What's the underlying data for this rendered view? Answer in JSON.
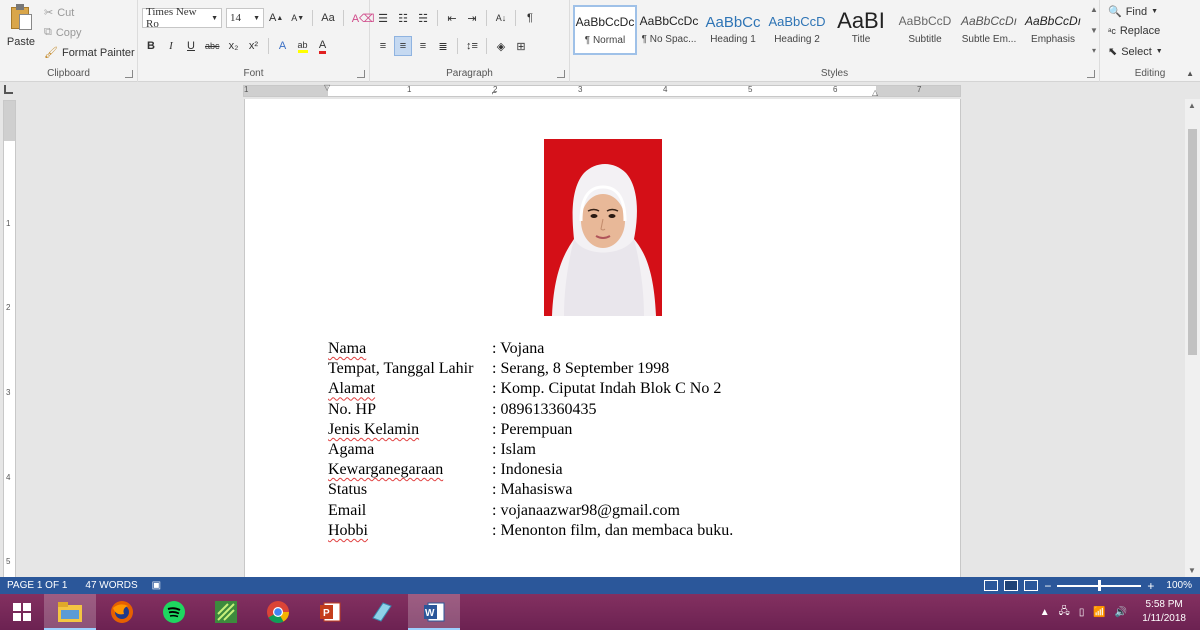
{
  "ribbon": {
    "clipboard": {
      "paste": "Paste",
      "cut": "Cut",
      "copy": "Copy",
      "format_painter": "Format Painter",
      "label": "Clipboard"
    },
    "font": {
      "family": "Times New Ro",
      "size": "14",
      "grow": "A",
      "shrink": "A",
      "change_case": "Aa",
      "bold": "B",
      "italic": "I",
      "underline": "U",
      "strikethrough": "abc",
      "subscript": "x₂",
      "superscript": "x²",
      "text_effects": "A",
      "highlight": "ab",
      "font_color": "A",
      "label": "Font"
    },
    "paragraph": {
      "show_marks": "¶",
      "label": "Paragraph"
    },
    "styles": {
      "items": [
        {
          "preview": "AaBbCcDc",
          "name": "¶ Normal"
        },
        {
          "preview": "AaBbCcDc",
          "name": "¶ No Spac..."
        },
        {
          "preview": "AaBbCc",
          "name": "Heading 1"
        },
        {
          "preview": "AaBbCcD",
          "name": "Heading 2"
        },
        {
          "preview": "AaBI",
          "name": "Title"
        },
        {
          "preview": "AaBbCcD",
          "name": "Subtitle"
        },
        {
          "preview": "AaBbCcDı",
          "name": "Subtle Em..."
        },
        {
          "preview": "AaBbCcDı",
          "name": "Emphasis"
        }
      ],
      "label": "Styles"
    },
    "editing": {
      "find": "Find",
      "replace": "Replace",
      "select": "Select",
      "label": "Editing"
    }
  },
  "ruler": {
    "h_numbers": [
      "1",
      "1",
      "2",
      "3",
      "4",
      "5",
      "6",
      "7"
    ],
    "v_numbers": [
      "1",
      "2",
      "3",
      "4",
      "5"
    ]
  },
  "document": {
    "rows": [
      {
        "label": "Nama",
        "value": ": Vojana"
      },
      {
        "label": "Tempat, Tanggal Lahir",
        "value": ": Serang, 8 September 1998"
      },
      {
        "label": "Alamat",
        "value": ": Komp. Ciputat Indah Blok C No 2"
      },
      {
        "label": "No. HP",
        "value": ": 089613360435"
      },
      {
        "label": "Jenis Kelamin",
        "value": ": Perempuan"
      },
      {
        "label": "Agama",
        "value": ": Islam"
      },
      {
        "label": "Kewarganegaraan",
        "value": ": Indonesia"
      },
      {
        "label": "Status",
        "value": ": Mahasiswa"
      },
      {
        "label": "Email",
        "value": ": vojanaazwar98@gmail.com"
      },
      {
        "label": "Hobbi",
        "value": ": Menonton film, dan membaca buku."
      }
    ],
    "photo_background": "#d40f17"
  },
  "status_bar": {
    "page": "PAGE 1 OF 1",
    "words": "47 WORDS",
    "zoom_minus": "−",
    "zoom_plus": "+",
    "zoom": "100%",
    "color": "#2b579a"
  },
  "taskbar": {
    "apps": [
      "start",
      "file-explorer",
      "firefox",
      "spotify",
      "app",
      "chrome",
      "powerpoint",
      "app",
      "word"
    ],
    "time": "5:58 PM",
    "date": "1/11/2018",
    "color": "#7a2a5a"
  }
}
